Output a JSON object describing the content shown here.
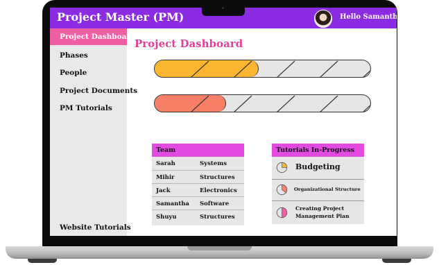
{
  "app": {
    "title": "Project Master (PM)",
    "greeting": "Hello Samantha!"
  },
  "sidebar": {
    "items": [
      {
        "label": "Project Dashboard",
        "active": true
      },
      {
        "label": "Phases"
      },
      {
        "label": "People"
      },
      {
        "label": "Project Documents"
      },
      {
        "label": "PM Tutorials"
      }
    ],
    "bottom_item": "Website Tutorials"
  },
  "main": {
    "title": "Project Dashboard"
  },
  "progress_bars": [
    {
      "fill_fraction": 0.48,
      "color": "#fbb631"
    },
    {
      "fill_fraction": 0.33,
      "color": "#f77e67"
    }
  ],
  "team": {
    "header": "Team",
    "rows": [
      [
        "Sarah",
        "Systems"
      ],
      [
        "Mihir",
        "Structures"
      ],
      [
        "Jack",
        "Electronics"
      ],
      [
        "Samantha",
        "Software"
      ],
      [
        "Shuyu",
        "Structures"
      ]
    ]
  },
  "tutorials": {
    "header": "Tutorials In-Progress",
    "items": [
      {
        "label": "Budgeting",
        "progress": 0.25,
        "color": "#fbb631"
      },
      {
        "label": "Organizational Structure",
        "progress": 0.35,
        "color": "#f77e67"
      },
      {
        "label": "Creating Project\nManagement Plan",
        "progress": 0.5,
        "color": "#ef5fa3"
      }
    ]
  },
  "colors": {
    "accent": "#8b2be2",
    "pink": "#ef5fa3",
    "title_pink": "#e0409b",
    "header_magenta": "#e24ae1"
  }
}
